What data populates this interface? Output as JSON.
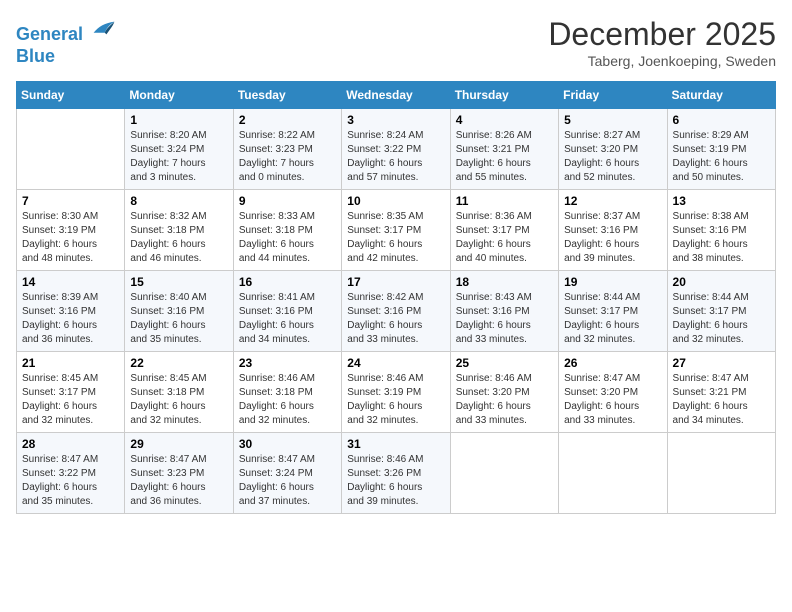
{
  "header": {
    "logo_line1": "General",
    "logo_line2": "Blue",
    "month": "December 2025",
    "location": "Taberg, Joenkoeping, Sweden"
  },
  "days_of_week": [
    "Sunday",
    "Monday",
    "Tuesday",
    "Wednesday",
    "Thursday",
    "Friday",
    "Saturday"
  ],
  "weeks": [
    [
      {
        "day": "",
        "info": ""
      },
      {
        "day": "1",
        "info": "Sunrise: 8:20 AM\nSunset: 3:24 PM\nDaylight: 7 hours\nand 3 minutes."
      },
      {
        "day": "2",
        "info": "Sunrise: 8:22 AM\nSunset: 3:23 PM\nDaylight: 7 hours\nand 0 minutes."
      },
      {
        "day": "3",
        "info": "Sunrise: 8:24 AM\nSunset: 3:22 PM\nDaylight: 6 hours\nand 57 minutes."
      },
      {
        "day": "4",
        "info": "Sunrise: 8:26 AM\nSunset: 3:21 PM\nDaylight: 6 hours\nand 55 minutes."
      },
      {
        "day": "5",
        "info": "Sunrise: 8:27 AM\nSunset: 3:20 PM\nDaylight: 6 hours\nand 52 minutes."
      },
      {
        "day": "6",
        "info": "Sunrise: 8:29 AM\nSunset: 3:19 PM\nDaylight: 6 hours\nand 50 minutes."
      }
    ],
    [
      {
        "day": "7",
        "info": "Sunrise: 8:30 AM\nSunset: 3:19 PM\nDaylight: 6 hours\nand 48 minutes."
      },
      {
        "day": "8",
        "info": "Sunrise: 8:32 AM\nSunset: 3:18 PM\nDaylight: 6 hours\nand 46 minutes."
      },
      {
        "day": "9",
        "info": "Sunrise: 8:33 AM\nSunset: 3:18 PM\nDaylight: 6 hours\nand 44 minutes."
      },
      {
        "day": "10",
        "info": "Sunrise: 8:35 AM\nSunset: 3:17 PM\nDaylight: 6 hours\nand 42 minutes."
      },
      {
        "day": "11",
        "info": "Sunrise: 8:36 AM\nSunset: 3:17 PM\nDaylight: 6 hours\nand 40 minutes."
      },
      {
        "day": "12",
        "info": "Sunrise: 8:37 AM\nSunset: 3:16 PM\nDaylight: 6 hours\nand 39 minutes."
      },
      {
        "day": "13",
        "info": "Sunrise: 8:38 AM\nSunset: 3:16 PM\nDaylight: 6 hours\nand 38 minutes."
      }
    ],
    [
      {
        "day": "14",
        "info": "Sunrise: 8:39 AM\nSunset: 3:16 PM\nDaylight: 6 hours\nand 36 minutes."
      },
      {
        "day": "15",
        "info": "Sunrise: 8:40 AM\nSunset: 3:16 PM\nDaylight: 6 hours\nand 35 minutes."
      },
      {
        "day": "16",
        "info": "Sunrise: 8:41 AM\nSunset: 3:16 PM\nDaylight: 6 hours\nand 34 minutes."
      },
      {
        "day": "17",
        "info": "Sunrise: 8:42 AM\nSunset: 3:16 PM\nDaylight: 6 hours\nand 33 minutes."
      },
      {
        "day": "18",
        "info": "Sunrise: 8:43 AM\nSunset: 3:16 PM\nDaylight: 6 hours\nand 33 minutes."
      },
      {
        "day": "19",
        "info": "Sunrise: 8:44 AM\nSunset: 3:17 PM\nDaylight: 6 hours\nand 32 minutes."
      },
      {
        "day": "20",
        "info": "Sunrise: 8:44 AM\nSunset: 3:17 PM\nDaylight: 6 hours\nand 32 minutes."
      }
    ],
    [
      {
        "day": "21",
        "info": "Sunrise: 8:45 AM\nSunset: 3:17 PM\nDaylight: 6 hours\nand 32 minutes."
      },
      {
        "day": "22",
        "info": "Sunrise: 8:45 AM\nSunset: 3:18 PM\nDaylight: 6 hours\nand 32 minutes."
      },
      {
        "day": "23",
        "info": "Sunrise: 8:46 AM\nSunset: 3:18 PM\nDaylight: 6 hours\nand 32 minutes."
      },
      {
        "day": "24",
        "info": "Sunrise: 8:46 AM\nSunset: 3:19 PM\nDaylight: 6 hours\nand 32 minutes."
      },
      {
        "day": "25",
        "info": "Sunrise: 8:46 AM\nSunset: 3:20 PM\nDaylight: 6 hours\nand 33 minutes."
      },
      {
        "day": "26",
        "info": "Sunrise: 8:47 AM\nSunset: 3:20 PM\nDaylight: 6 hours\nand 33 minutes."
      },
      {
        "day": "27",
        "info": "Sunrise: 8:47 AM\nSunset: 3:21 PM\nDaylight: 6 hours\nand 34 minutes."
      }
    ],
    [
      {
        "day": "28",
        "info": "Sunrise: 8:47 AM\nSunset: 3:22 PM\nDaylight: 6 hours\nand 35 minutes."
      },
      {
        "day": "29",
        "info": "Sunrise: 8:47 AM\nSunset: 3:23 PM\nDaylight: 6 hours\nand 36 minutes."
      },
      {
        "day": "30",
        "info": "Sunrise: 8:47 AM\nSunset: 3:24 PM\nDaylight: 6 hours\nand 37 minutes."
      },
      {
        "day": "31",
        "info": "Sunrise: 8:46 AM\nSunset: 3:26 PM\nDaylight: 6 hours\nand 39 minutes."
      },
      {
        "day": "",
        "info": ""
      },
      {
        "day": "",
        "info": ""
      },
      {
        "day": "",
        "info": ""
      }
    ]
  ]
}
